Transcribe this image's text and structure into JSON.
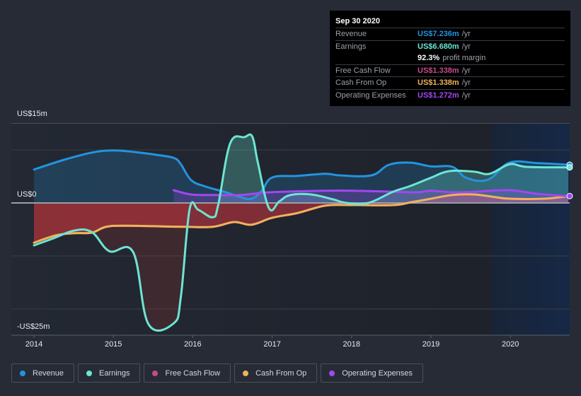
{
  "tooltip": {
    "date": "Sep 30 2020",
    "rows": [
      {
        "label": "Revenue",
        "value": "US$7.236m",
        "unit": "/yr",
        "color": "#2394df"
      },
      {
        "label": "Earnings",
        "value": "US$6.680m",
        "unit": "/yr",
        "color": "#6ce5d4"
      },
      {
        "label": "",
        "value": "92.3%",
        "unit": "profit margin",
        "color": "#ffffff"
      },
      {
        "label": "Free Cash Flow",
        "value": "US$1.338m",
        "unit": "/yr",
        "color": "#c54c8b"
      },
      {
        "label": "Cash From Op",
        "value": "US$1.338m",
        "unit": "/yr",
        "color": "#f0b25b"
      },
      {
        "label": "Operating Expenses",
        "value": "US$1.272m",
        "unit": "/yr",
        "color": "#a347f2"
      }
    ]
  },
  "legend": [
    {
      "label": "Revenue",
      "color": "#2394df"
    },
    {
      "label": "Earnings",
      "color": "#6ce5d4"
    },
    {
      "label": "Free Cash Flow",
      "color": "#c54c8b"
    },
    {
      "label": "Cash From Op",
      "color": "#f0b25b"
    },
    {
      "label": "Operating Expenses",
      "color": "#a347f2"
    }
  ],
  "chart_data": {
    "type": "line",
    "title": "",
    "xlabel": "",
    "ylabel": "",
    "y_unit": "US$ millions",
    "ylim": [
      -25,
      15
    ],
    "xlim": [
      2013.7,
      2020.75
    ],
    "y_tick_labels": [
      {
        "value": 15,
        "label": "US$15m"
      },
      {
        "value": 0,
        "label": "US$0"
      },
      {
        "value": -25,
        "label": "-US$25m"
      }
    ],
    "gridlines_at": [
      15,
      10,
      0,
      -10,
      -20
    ],
    "x_ticks": [
      2014,
      2015,
      2016,
      2017,
      2018,
      2019,
      2020
    ],
    "x_tick_labels": [
      "2014",
      "2015",
      "2016",
      "2017",
      "2018",
      "2019",
      "2020"
    ],
    "forecast_shade_from": 2019.75,
    "legend_position": "bottom",
    "series": [
      {
        "name": "Revenue",
        "color": "#2394df",
        "fill": true,
        "points": [
          [
            2014.0,
            6.3
          ],
          [
            2014.37,
            8.1
          ],
          [
            2014.73,
            9.5
          ],
          [
            2015.0,
            9.9
          ],
          [
            2015.27,
            9.6
          ],
          [
            2015.53,
            9.1
          ],
          [
            2015.76,
            8.5
          ],
          [
            2015.85,
            7.3
          ],
          [
            2015.98,
            4.3
          ],
          [
            2016.16,
            3.1
          ],
          [
            2016.42,
            2.0
          ],
          [
            2016.6,
            1.1
          ],
          [
            2016.74,
            0.8
          ],
          [
            2016.87,
            2.3
          ],
          [
            2017.0,
            4.8
          ],
          [
            2017.32,
            5.1
          ],
          [
            2017.67,
            5.5
          ],
          [
            2017.85,
            5.2
          ],
          [
            2018.25,
            5.2
          ],
          [
            2018.47,
            7.2
          ],
          [
            2018.74,
            7.6
          ],
          [
            2019.0,
            6.9
          ],
          [
            2019.27,
            6.8
          ],
          [
            2019.45,
            4.7
          ],
          [
            2019.72,
            4.4
          ],
          [
            2019.99,
            7.6
          ],
          [
            2020.35,
            7.5
          ],
          [
            2020.73,
            7.2
          ]
        ]
      },
      {
        "name": "Earnings",
        "color": "#6ce5d4",
        "fill": true,
        "points": [
          [
            2014.0,
            -8.0
          ],
          [
            2014.24,
            -6.7
          ],
          [
            2014.51,
            -5.2
          ],
          [
            2014.73,
            -5.5
          ],
          [
            2014.95,
            -9.1
          ],
          [
            2015.25,
            -9.3
          ],
          [
            2015.44,
            -22.8
          ],
          [
            2015.76,
            -22.7
          ],
          [
            2015.85,
            -17.7
          ],
          [
            2015.96,
            -1.2
          ],
          [
            2016.07,
            -1.3
          ],
          [
            2016.25,
            -2.7
          ],
          [
            2016.32,
            -0.4
          ],
          [
            2016.47,
            11.2
          ],
          [
            2016.65,
            12.4
          ],
          [
            2016.75,
            12.5
          ],
          [
            2016.82,
            7.6
          ],
          [
            2016.96,
            -1.0
          ],
          [
            2017.09,
            0.3
          ],
          [
            2017.23,
            1.5
          ],
          [
            2017.49,
            1.6
          ],
          [
            2017.76,
            0.7
          ],
          [
            2017.94,
            0.0
          ],
          [
            2018.21,
            0.0
          ],
          [
            2018.52,
            2.1
          ],
          [
            2018.74,
            3.2
          ],
          [
            2018.99,
            4.7
          ],
          [
            2019.23,
            6.0
          ],
          [
            2019.54,
            5.9
          ],
          [
            2019.74,
            5.5
          ],
          [
            2019.99,
            7.3
          ],
          [
            2020.21,
            6.8
          ],
          [
            2020.73,
            6.7
          ]
        ]
      },
      {
        "name": "Free Cash Flow",
        "color": "#c54c8b",
        "fill": true,
        "points": [
          [
            2014.0,
            -7.5
          ],
          [
            2014.28,
            -6.1
          ],
          [
            2014.51,
            -5.7
          ],
          [
            2014.73,
            -5.6
          ],
          [
            2014.91,
            -4.5
          ],
          [
            2015.18,
            -4.3
          ],
          [
            2015.89,
            -4.5
          ],
          [
            2016.25,
            -4.5
          ],
          [
            2016.52,
            -3.6
          ],
          [
            2016.74,
            -4.1
          ],
          [
            2017.0,
            -2.8
          ],
          [
            2017.32,
            -1.9
          ],
          [
            2017.67,
            -0.5
          ],
          [
            2017.99,
            -0.4
          ],
          [
            2018.52,
            -0.4
          ],
          [
            2018.74,
            0.1
          ],
          [
            2019.0,
            0.8
          ],
          [
            2019.27,
            1.5
          ],
          [
            2019.54,
            1.6
          ],
          [
            2019.81,
            1.1
          ],
          [
            2019.99,
            0.8
          ],
          [
            2020.43,
            0.8
          ],
          [
            2020.73,
            1.3
          ]
        ]
      },
      {
        "name": "Cash From Op",
        "color": "#f0b25b",
        "fill": false,
        "points": [
          [
            2014.0,
            -7.5
          ],
          [
            2014.28,
            -6.1
          ],
          [
            2014.51,
            -5.7
          ],
          [
            2014.73,
            -5.6
          ],
          [
            2014.91,
            -4.5
          ],
          [
            2015.18,
            -4.3
          ],
          [
            2015.89,
            -4.5
          ],
          [
            2016.25,
            -4.5
          ],
          [
            2016.52,
            -3.6
          ],
          [
            2016.74,
            -4.1
          ],
          [
            2017.0,
            -2.8
          ],
          [
            2017.32,
            -1.9
          ],
          [
            2017.67,
            -0.5
          ],
          [
            2017.99,
            -0.4
          ],
          [
            2018.52,
            -0.4
          ],
          [
            2018.74,
            0.1
          ],
          [
            2019.0,
            0.8
          ],
          [
            2019.27,
            1.5
          ],
          [
            2019.54,
            1.6
          ],
          [
            2019.81,
            1.1
          ],
          [
            2019.99,
            0.8
          ],
          [
            2020.43,
            0.8
          ],
          [
            2020.73,
            1.3
          ]
        ]
      },
      {
        "name": "Operating Expenses",
        "color": "#a347f2",
        "fill": true,
        "points": [
          [
            2015.76,
            2.4
          ],
          [
            2015.98,
            1.6
          ],
          [
            2016.25,
            1.5
          ],
          [
            2016.6,
            1.5
          ],
          [
            2016.96,
            2.0
          ],
          [
            2017.67,
            2.3
          ],
          [
            2018.03,
            2.3
          ],
          [
            2018.56,
            2.1
          ],
          [
            2018.83,
            2.0
          ],
          [
            2019.0,
            2.3
          ],
          [
            2019.27,
            2.0
          ],
          [
            2019.54,
            2.1
          ],
          [
            2019.99,
            2.4
          ],
          [
            2020.35,
            1.7
          ],
          [
            2020.73,
            1.3
          ]
        ]
      }
    ]
  }
}
